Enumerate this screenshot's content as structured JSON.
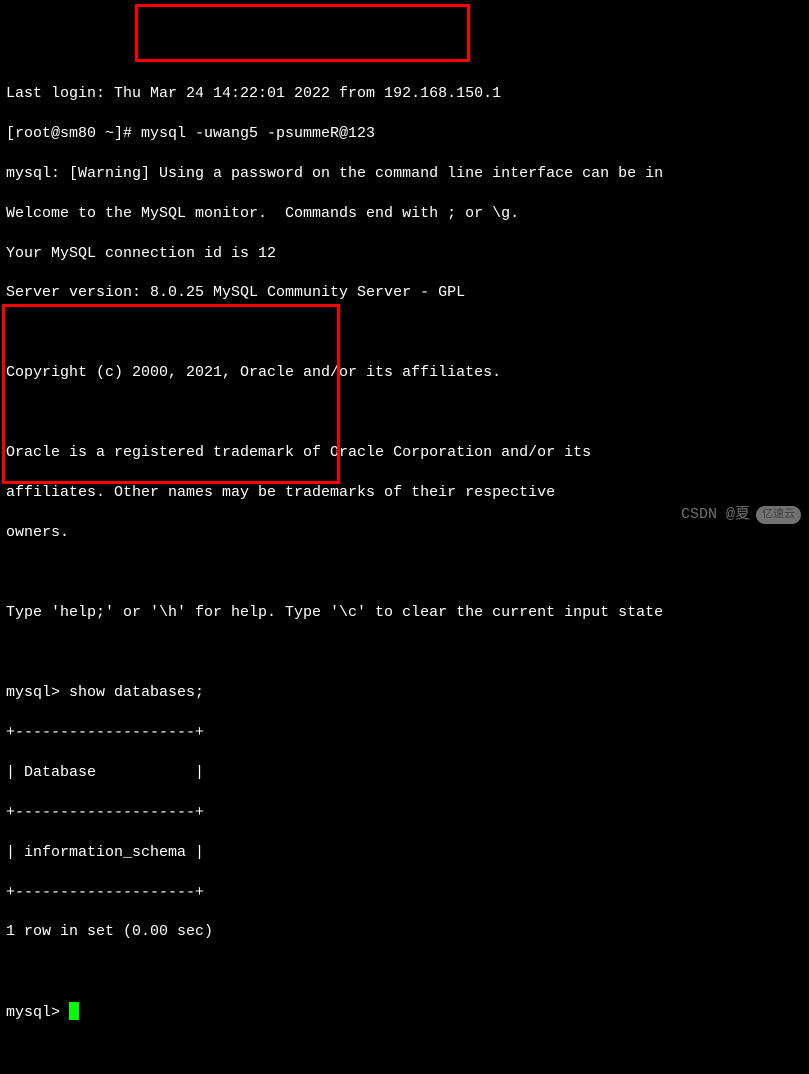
{
  "terminal": {
    "lines": [
      "Last login: Thu Mar 24 14:22:01 2022 from 192.168.150.1",
      "[root@sm80 ~]# mysql -uwang5 -psummeR@123",
      "mysql: [Warning] Using a password on the command line interface can be in",
      "Welcome to the MySQL monitor.  Commands end with ; or \\g.",
      "Your MySQL connection id is 12",
      "Server version: 8.0.25 MySQL Community Server - GPL",
      "",
      "Copyright (c) 2000, 2021, Oracle and/or its affiliates.",
      "",
      "Oracle is a registered trademark of Oracle Corporation and/or its",
      "affiliates. Other names may be trademarks of their respective",
      "owners.",
      "",
      "Type 'help;' or '\\h' for help. Type '\\c' to clear the current input state",
      "",
      "mysql> show databases;",
      "+--------------------+",
      "| Database           |",
      "+--------------------+",
      "| information_schema |",
      "+--------------------+",
      "1 row in set (0.00 sec)",
      "",
      "mysql> "
    ]
  },
  "watermark": {
    "text": "CSDN @夏",
    "logo": "亿速云"
  }
}
